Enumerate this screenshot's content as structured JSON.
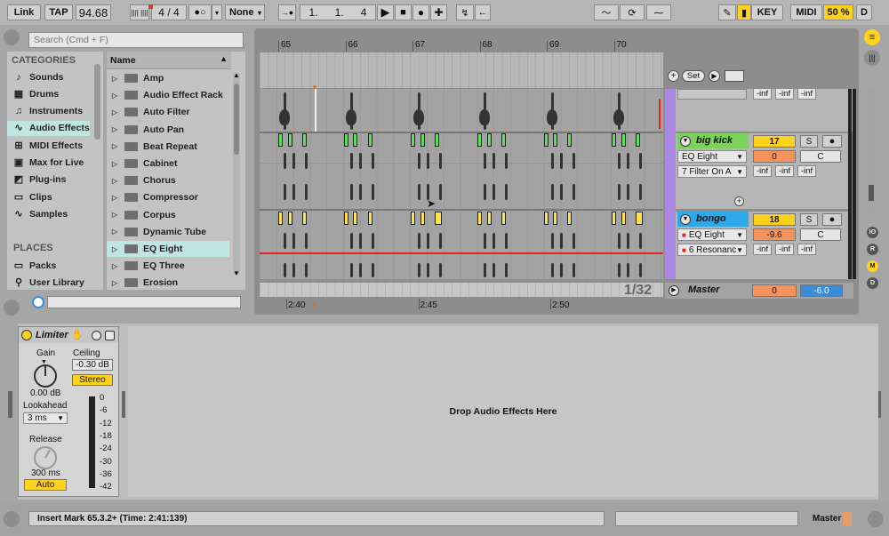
{
  "transport": {
    "link": "Link",
    "tap": "TAP",
    "tempo": "94.68",
    "metronome": "||||  ||||",
    "meter_num": "4",
    "meter_slash": "/",
    "meter_den": "4",
    "quant": "●○",
    "quant_arrow": "▾",
    "none": "None",
    "none_arrow": "▾",
    "follow": "→●",
    "pos_bar": "1.",
    "pos_beat": "1.",
    "pos_sixteenth": "4",
    "play": "▶",
    "stop": "■",
    "rec": "●",
    "add": "✚",
    "loop_icon": "↯",
    "back_icon": "←",
    "curve1": "〜",
    "curve2": "⟳",
    "curve3": "⁓",
    "pencil": "✎",
    "midi_icon": "▮",
    "key": "KEY",
    "midi": "MIDI",
    "cpu": "50 %",
    "d": "D"
  },
  "search": {
    "placeholder": "Search (Cmd + F)"
  },
  "categories": {
    "heading": "CATEGORIES",
    "items": [
      {
        "label": "Sounds",
        "icon": "♪"
      },
      {
        "label": "Drums",
        "icon": "▦"
      },
      {
        "label": "Instruments",
        "icon": "♫"
      },
      {
        "label": "Audio Effects",
        "icon": "∿"
      },
      {
        "label": "MIDI Effects",
        "icon": "⊞"
      },
      {
        "label": "Max for Live",
        "icon": "▣"
      },
      {
        "label": "Plug-ins",
        "icon": "◩"
      },
      {
        "label": "Clips",
        "icon": "▭"
      },
      {
        "label": "Samples",
        "icon": "∿"
      }
    ],
    "places_heading": "PLACES",
    "places": [
      {
        "label": "Packs",
        "icon": "▭"
      },
      {
        "label": "User Library",
        "icon": "⚲"
      }
    ]
  },
  "browser": {
    "header": "Name",
    "items": [
      "Amp",
      "Audio Effect Rack",
      "Auto Filter",
      "Auto Pan",
      "Beat Repeat",
      "Cabinet",
      "Chorus",
      "Compressor",
      "Corpus",
      "Dynamic Tube",
      "EQ Eight",
      "EQ Three",
      "Erosion"
    ]
  },
  "arrangement": {
    "bars": [
      "65",
      "66",
      "67",
      "68",
      "69",
      "70"
    ],
    "times": [
      "2:40",
      "2:45",
      "2:50"
    ],
    "zoom": "1/32",
    "set_label": "Set"
  },
  "tracks": [
    {
      "name": "",
      "vol": "",
      "infs": [
        "-inf",
        "-inf",
        "-inf"
      ]
    },
    {
      "name": "big kick",
      "number": "17",
      "solo": "S",
      "vol": "0",
      "pan": "C",
      "device1": "EQ Eight",
      "device2": "7 Filter On A",
      "infs": [
        "-inf",
        "-inf",
        "-inf"
      ],
      "color": "#7cd35a"
    },
    {
      "name": "bongo",
      "number": "18",
      "solo": "S",
      "vol": "-9.6",
      "pan": "C",
      "device1": "EQ Eight",
      "device2": "6 Resonanc",
      "infs": [
        "-inf",
        "-inf",
        "-inf"
      ],
      "color": "#2fa8e8"
    }
  ],
  "master": {
    "label": "Master",
    "vol": "0",
    "meter": "-6.0"
  },
  "side_buttons": [
    "IO",
    "R",
    "M",
    "D"
  ],
  "device": {
    "name": "Limiter",
    "gain_label": "Gain",
    "gain_value": "0.00 dB",
    "ceiling_label": "Ceiling",
    "ceiling_value": "-0.30 dB",
    "stereo": "Stereo",
    "lookahead_label": "Lookahead",
    "lookahead_value": "3 ms",
    "release_label": "Release",
    "release_value": "300 ms",
    "auto": "Auto",
    "scale": [
      "0",
      "-6",
      "-12",
      "-18",
      "-24",
      "-30",
      "-36",
      "-42"
    ]
  },
  "drop_text": "Drop Audio Effects Here",
  "status": {
    "text": "Insert Mark 65.3.2+ (Time: 2:41:139)",
    "track": "Master"
  },
  "colors": {
    "accent_select": "#bfe6e0",
    "cpu": "#ffd21e",
    "purple": "#a98ae0"
  }
}
